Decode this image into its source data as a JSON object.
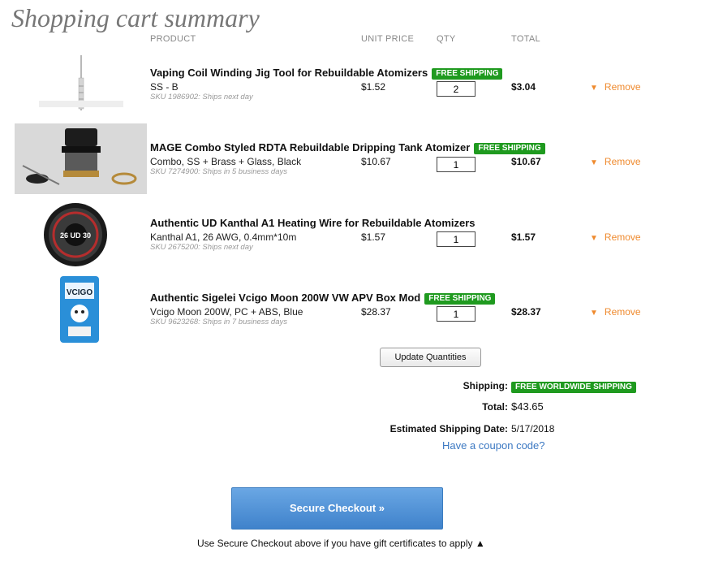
{
  "page": {
    "title": "Shopping cart summary"
  },
  "columns": {
    "product": "PRODUCT",
    "unit_price": "UNIT PRICE",
    "qty": "QTY",
    "total": "TOTAL"
  },
  "badge_label": "FREE SHIPPING",
  "items": [
    {
      "name": "Vaping Coil Winding Jig Tool for Rebuildable Atomizers",
      "free_shipping": true,
      "variant": "SS - B",
      "sku": "SKU 1986902: Ships next day",
      "unit_price": "$1.52",
      "qty": "2",
      "total": "$3.04",
      "remove": "Remove",
      "icon": "winding-jig-image"
    },
    {
      "name": "MAGE Combo Styled RDTA Rebuildable Dripping Tank Atomizer",
      "free_shipping": true,
      "variant": "Combo, SS + Brass + Glass, Black",
      "sku": "SKU 7274900: Ships in 5 business days",
      "unit_price": "$10.67",
      "qty": "1",
      "total": "$10.67",
      "remove": "Remove",
      "icon": "rdta-atomizer-image"
    },
    {
      "name": "Authentic UD Kanthal A1 Heating Wire for Rebuildable Atomizers",
      "free_shipping": false,
      "variant": "Kanthal A1, 26 AWG, 0.4mm*10m",
      "sku": "SKU 2675200: Ships next day",
      "unit_price": "$1.57",
      "qty": "1",
      "total": "$1.57",
      "remove": "Remove",
      "icon": "wire-spool-image"
    },
    {
      "name": "Authentic Sigelei Vcigo Moon 200W VW APV Box Mod",
      "free_shipping": true,
      "variant": "Vcigo Moon 200W, PC + ABS, Blue",
      "sku": "SKU 9623268: Ships in 7 business days",
      "unit_price": "$28.37",
      "qty": "1",
      "total": "$28.37",
      "remove": "Remove",
      "icon": "box-mod-image"
    }
  ],
  "image_text": {
    "wire_spool": "26 UD 30",
    "box_mod": "VCIGO"
  },
  "actions": {
    "update_quantities": "Update Quantities",
    "coupon_link": "Have a coupon code?",
    "checkout": "Secure Checkout »",
    "gift_note": "Use Secure Checkout above if you have gift certificates to apply ▲"
  },
  "summary": {
    "shipping_label": "Shipping:",
    "shipping_value": "FREE WORLDWIDE SHIPPING",
    "total_label": "Total:",
    "total_value": "$43.65",
    "est_date_label": "Estimated Shipping Date:",
    "est_date_value": "5/17/2018"
  },
  "colors": {
    "accent_orange": "#ef8a2e",
    "free_green": "#1f9a1f",
    "link_blue": "#3b78c2",
    "checkout_blue": "#4a8ad4"
  }
}
